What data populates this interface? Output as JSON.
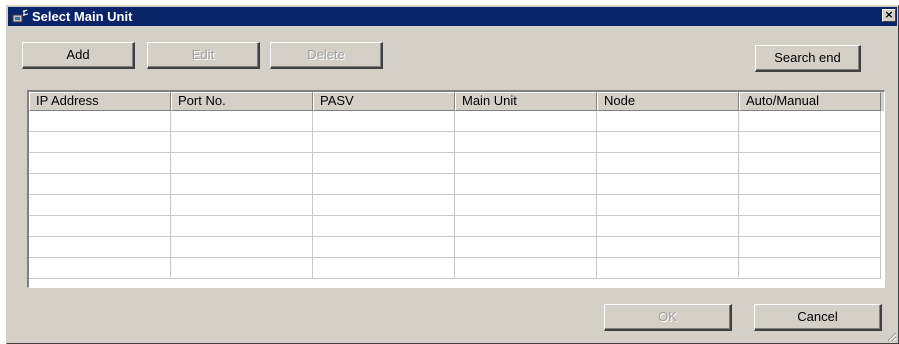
{
  "window": {
    "title": "Select Main Unit",
    "close_glyph": "×"
  },
  "toolbar": {
    "add_label": "Add",
    "edit_label": "Edit",
    "delete_label": "Delete",
    "search_end_label": "Search end"
  },
  "table": {
    "columns": [
      "IP Address",
      "Port No.",
      "PASV",
      "Main Unit",
      "Node",
      "Auto/Manual"
    ],
    "empty_rows": 8
  },
  "footer": {
    "ok_label": "OK",
    "cancel_label": "Cancel"
  },
  "icons": {
    "title_icon": "network-device-icon",
    "resize_grip": "resize-grip-icon"
  },
  "colors": {
    "title_bar": "#0a246a",
    "face": "#d4d0c8",
    "disabled_text": "#a0a0a0"
  }
}
